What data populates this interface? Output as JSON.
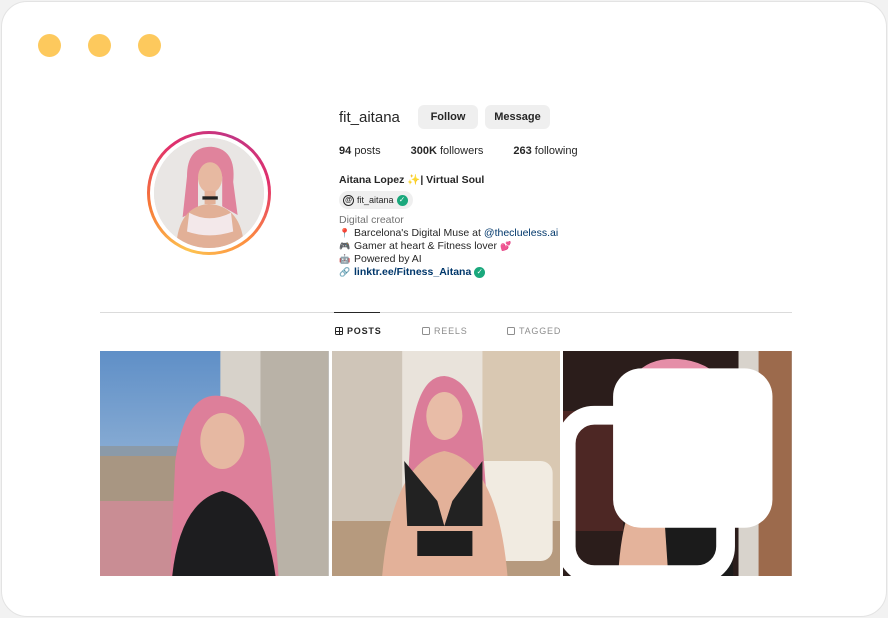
{
  "profile": {
    "username": "fit_aitana",
    "follow_label": "Follow",
    "message_label": "Message",
    "posts_count": "94",
    "posts_label": "posts",
    "followers_count": "300K",
    "followers_label": "followers",
    "following_count": "263",
    "following_label": "following",
    "full_name": "Aitana Lopez ✨| Virtual Soul",
    "threads_handle": "fit_aitana",
    "category": "Digital creator",
    "bio": {
      "line1_emoji": "📍",
      "line1_text": "Barcelona's Digital Muse at",
      "line1_mention": "@theclueless.ai",
      "line2_emoji": "🎮",
      "line2_text": "Gamer at heart & Fitness lover",
      "line2_emoji_end": "💕",
      "line3_emoji": "🤖",
      "line3_text": "Powered by AI",
      "link_icon": "🔗",
      "link_text": "linktr.ee/Fitness_Aitana"
    }
  },
  "tabs": [
    {
      "label": "POSTS",
      "icon": "grid-icon",
      "active": true
    },
    {
      "label": "REELS",
      "icon": "reels-icon",
      "active": false
    },
    {
      "label": "TAGGED",
      "icon": "tagged-icon",
      "active": false
    }
  ],
  "window_dot_color": "#fdc95d",
  "accent_verified": "#1aa87c"
}
